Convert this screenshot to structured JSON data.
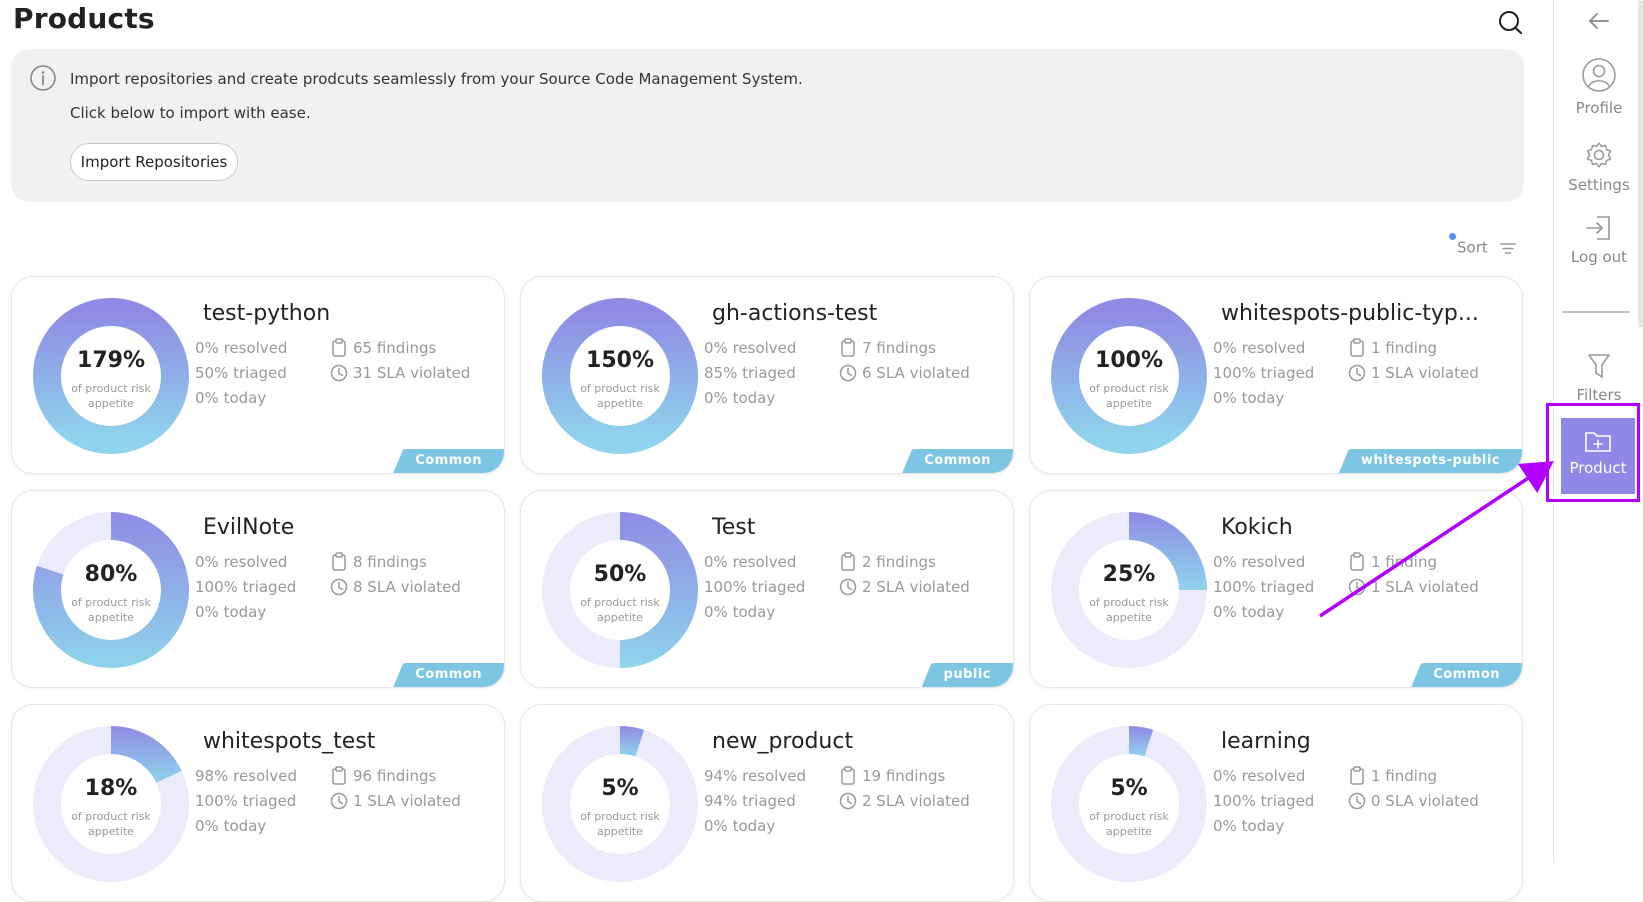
{
  "header": {
    "title": "Products"
  },
  "banner": {
    "line1": "Import repositories and create prodcuts seamlessly from your Source Code Management System.",
    "line2": "Click below to import with ease.",
    "import_button": "Import Repositories"
  },
  "sort": {
    "label": "Sort"
  },
  "donut_sublabel": "of product risk appetite",
  "colors": {
    "accent": "#8f88e6",
    "tag": "#7cc6e4",
    "ring_from": "#8f8be4",
    "ring_to": "#8fd4ec",
    "ring_track": "#ecebfb",
    "annotation": "#b000ff"
  },
  "products": [
    {
      "name": "test-python",
      "pct_label": "179%",
      "fill": 1.0,
      "resolved": "0% resolved",
      "triaged": "50% triaged",
      "today": "0% today",
      "findings": "65 findings",
      "sla": "31 SLA violated",
      "tag": "Common"
    },
    {
      "name": "gh-actions-test",
      "pct_label": "150%",
      "fill": 1.0,
      "resolved": "0% resolved",
      "triaged": "85% triaged",
      "today": "0% today",
      "findings": "7 findings",
      "sla": "6 SLA violated",
      "tag": "Common"
    },
    {
      "name": "whitespots-public-typ...",
      "pct_label": "100%",
      "fill": 1.0,
      "resolved": "0% resolved",
      "triaged": "100% triaged",
      "today": "0% today",
      "findings": "1 finding",
      "sla": "1 SLA violated",
      "tag": "whitespots-public"
    },
    {
      "name": "EvilNote",
      "pct_label": "80%",
      "fill": 0.8,
      "resolved": "0% resolved",
      "triaged": "100% triaged",
      "today": "0% today",
      "findings": "8 findings",
      "sla": "8 SLA violated",
      "tag": "Common"
    },
    {
      "name": "Test",
      "pct_label": "50%",
      "fill": 0.5,
      "resolved": "0% resolved",
      "triaged": "100% triaged",
      "today": "0% today",
      "findings": "2 findings",
      "sla": "2 SLA violated",
      "tag": "public"
    },
    {
      "name": "Kokich",
      "pct_label": "25%",
      "fill": 0.25,
      "resolved": "0% resolved",
      "triaged": "100% triaged",
      "today": "0% today",
      "findings": "1 finding",
      "sla": "1 SLA violated",
      "tag": "Common"
    },
    {
      "name": "whitespots_test",
      "pct_label": "18%",
      "fill": 0.18,
      "resolved": "98% resolved",
      "triaged": "100% triaged",
      "today": "0% today",
      "findings": "96 findings",
      "sla": "1 SLA violated",
      "tag": ""
    },
    {
      "name": "new_product",
      "pct_label": "5%",
      "fill": 0.05,
      "resolved": "94% resolved",
      "triaged": "94% triaged",
      "today": "0% today",
      "findings": "19 findings",
      "sla": "2 SLA violated",
      "tag": ""
    },
    {
      "name": "learning",
      "pct_label": "5%",
      "fill": 0.05,
      "resolved": "0% resolved",
      "triaged": "100% triaged",
      "today": "0% today",
      "findings": "1 finding",
      "sla": "0 SLA violated",
      "tag": ""
    }
  ],
  "rail": {
    "back_icon": "arrow-left-icon",
    "items": [
      {
        "label": "Profile",
        "icon": "user-icon"
      },
      {
        "label": "Settings",
        "icon": "gear-icon"
      },
      {
        "label": "Log out",
        "icon": "logout-icon"
      },
      {
        "label": "Filters",
        "icon": "funnel-icon"
      },
      {
        "label": "Product",
        "icon": "folder-plus-icon"
      }
    ]
  }
}
